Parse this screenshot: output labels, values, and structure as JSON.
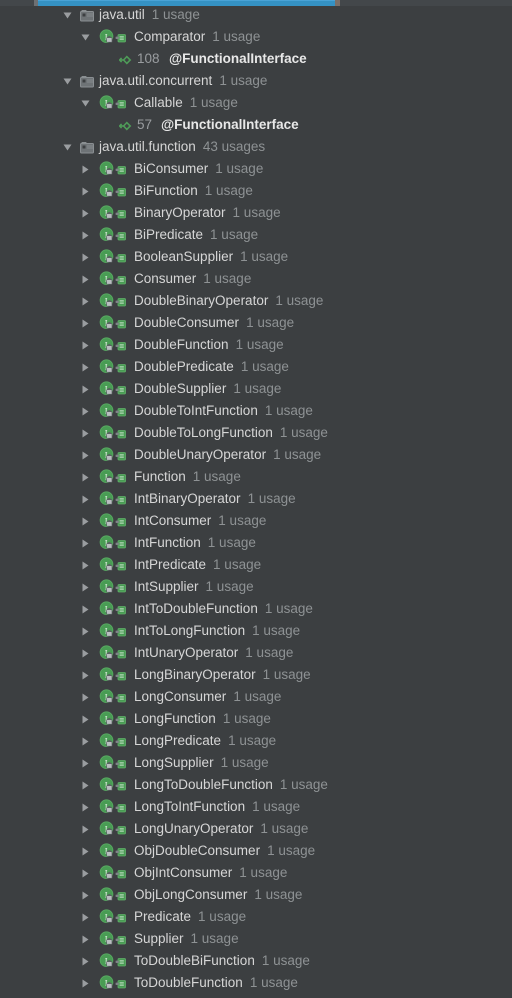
{
  "theme": {
    "background": "#3c3f41",
    "accent_blue": "#3592c4",
    "text": "#d6d6d6",
    "muted_text": "#8e9294",
    "icon_green": "#499c54"
  },
  "progress_bar": {
    "name": "indexing-progress-bar",
    "fill_percent": 58,
    "visible": true
  },
  "tree": {
    "name": "find-usages-tree",
    "rows": [
      {
        "level": 1,
        "kind": "package",
        "expanded": true,
        "label": "java.util",
        "count": "1 usage"
      },
      {
        "level": 2,
        "kind": "interface",
        "expanded": true,
        "label": "Comparator",
        "count": "1 usage"
      },
      {
        "level": 3,
        "kind": "usage",
        "line": "108",
        "text": "@FunctionalInterface"
      },
      {
        "level": 1,
        "kind": "package",
        "expanded": true,
        "label": "java.util.concurrent",
        "count": "1 usage"
      },
      {
        "level": 2,
        "kind": "interface",
        "expanded": true,
        "label": "Callable",
        "count": "1 usage"
      },
      {
        "level": 3,
        "kind": "usage",
        "line": "57",
        "text": "@FunctionalInterface"
      },
      {
        "level": 1,
        "kind": "package",
        "expanded": true,
        "label": "java.util.function",
        "count": "43 usages"
      },
      {
        "level": 2,
        "kind": "interface",
        "expanded": false,
        "label": "BiConsumer",
        "count": "1 usage"
      },
      {
        "level": 2,
        "kind": "interface",
        "expanded": false,
        "label": "BiFunction",
        "count": "1 usage"
      },
      {
        "level": 2,
        "kind": "interface",
        "expanded": false,
        "label": "BinaryOperator",
        "count": "1 usage"
      },
      {
        "level": 2,
        "kind": "interface",
        "expanded": false,
        "label": "BiPredicate",
        "count": "1 usage"
      },
      {
        "level": 2,
        "kind": "interface",
        "expanded": false,
        "label": "BooleanSupplier",
        "count": "1 usage"
      },
      {
        "level": 2,
        "kind": "interface",
        "expanded": false,
        "label": "Consumer",
        "count": "1 usage"
      },
      {
        "level": 2,
        "kind": "interface",
        "expanded": false,
        "label": "DoubleBinaryOperator",
        "count": "1 usage"
      },
      {
        "level": 2,
        "kind": "interface",
        "expanded": false,
        "label": "DoubleConsumer",
        "count": "1 usage"
      },
      {
        "level": 2,
        "kind": "interface",
        "expanded": false,
        "label": "DoubleFunction",
        "count": "1 usage"
      },
      {
        "level": 2,
        "kind": "interface",
        "expanded": false,
        "label": "DoublePredicate",
        "count": "1 usage"
      },
      {
        "level": 2,
        "kind": "interface",
        "expanded": false,
        "label": "DoubleSupplier",
        "count": "1 usage"
      },
      {
        "level": 2,
        "kind": "interface",
        "expanded": false,
        "label": "DoubleToIntFunction",
        "count": "1 usage"
      },
      {
        "level": 2,
        "kind": "interface",
        "expanded": false,
        "label": "DoubleToLongFunction",
        "count": "1 usage"
      },
      {
        "level": 2,
        "kind": "interface",
        "expanded": false,
        "label": "DoubleUnaryOperator",
        "count": "1 usage"
      },
      {
        "level": 2,
        "kind": "interface",
        "expanded": false,
        "label": "Function",
        "count": "1 usage"
      },
      {
        "level": 2,
        "kind": "interface",
        "expanded": false,
        "label": "IntBinaryOperator",
        "count": "1 usage"
      },
      {
        "level": 2,
        "kind": "interface",
        "expanded": false,
        "label": "IntConsumer",
        "count": "1 usage"
      },
      {
        "level": 2,
        "kind": "interface",
        "expanded": false,
        "label": "IntFunction",
        "count": "1 usage"
      },
      {
        "level": 2,
        "kind": "interface",
        "expanded": false,
        "label": "IntPredicate",
        "count": "1 usage"
      },
      {
        "level": 2,
        "kind": "interface",
        "expanded": false,
        "label": "IntSupplier",
        "count": "1 usage"
      },
      {
        "level": 2,
        "kind": "interface",
        "expanded": false,
        "label": "IntToDoubleFunction",
        "count": "1 usage"
      },
      {
        "level": 2,
        "kind": "interface",
        "expanded": false,
        "label": "IntToLongFunction",
        "count": "1 usage"
      },
      {
        "level": 2,
        "kind": "interface",
        "expanded": false,
        "label": "IntUnaryOperator",
        "count": "1 usage"
      },
      {
        "level": 2,
        "kind": "interface",
        "expanded": false,
        "label": "LongBinaryOperator",
        "count": "1 usage"
      },
      {
        "level": 2,
        "kind": "interface",
        "expanded": false,
        "label": "LongConsumer",
        "count": "1 usage"
      },
      {
        "level": 2,
        "kind": "interface",
        "expanded": false,
        "label": "LongFunction",
        "count": "1 usage"
      },
      {
        "level": 2,
        "kind": "interface",
        "expanded": false,
        "label": "LongPredicate",
        "count": "1 usage"
      },
      {
        "level": 2,
        "kind": "interface",
        "expanded": false,
        "label": "LongSupplier",
        "count": "1 usage"
      },
      {
        "level": 2,
        "kind": "interface",
        "expanded": false,
        "label": "LongToDoubleFunction",
        "count": "1 usage"
      },
      {
        "level": 2,
        "kind": "interface",
        "expanded": false,
        "label": "LongToIntFunction",
        "count": "1 usage"
      },
      {
        "level": 2,
        "kind": "interface",
        "expanded": false,
        "label": "LongUnaryOperator",
        "count": "1 usage"
      },
      {
        "level": 2,
        "kind": "interface",
        "expanded": false,
        "label": "ObjDoubleConsumer",
        "count": "1 usage"
      },
      {
        "level": 2,
        "kind": "interface",
        "expanded": false,
        "label": "ObjIntConsumer",
        "count": "1 usage"
      },
      {
        "level": 2,
        "kind": "interface",
        "expanded": false,
        "label": "ObjLongConsumer",
        "count": "1 usage"
      },
      {
        "level": 2,
        "kind": "interface",
        "expanded": false,
        "label": "Predicate",
        "count": "1 usage"
      },
      {
        "level": 2,
        "kind": "interface",
        "expanded": false,
        "label": "Supplier",
        "count": "1 usage"
      },
      {
        "level": 2,
        "kind": "interface",
        "expanded": false,
        "label": "ToDoubleBiFunction",
        "count": "1 usage"
      },
      {
        "level": 2,
        "kind": "interface",
        "expanded": false,
        "label": "ToDoubleFunction",
        "count": "1 usage"
      }
    ]
  }
}
